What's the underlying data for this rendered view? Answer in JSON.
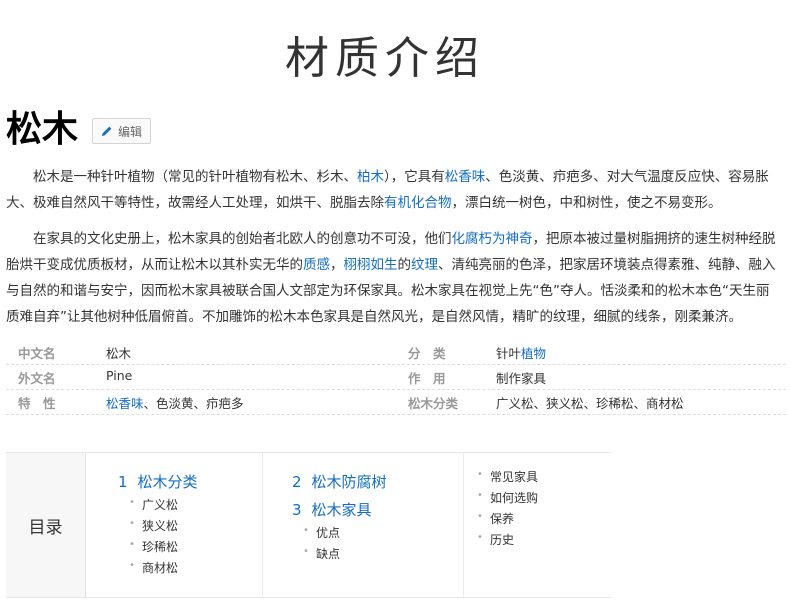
{
  "banner": "材质介绍",
  "title": "松木",
  "edit_label": "编辑",
  "para1": [
    {
      "t": "松木是一种针叶植物（常见的针叶植物有松木、杉木、"
    },
    {
      "t": "柏木",
      "link": true
    },
    {
      "t": "），它具有"
    },
    {
      "t": "松香味",
      "link": true
    },
    {
      "t": "、色淡黄、疖疤多、对大气温度反应快、容易胀大、极难自然风干等特性，故需经人工处理，如烘干、脱脂去除"
    },
    {
      "t": "有机化合物",
      "link": true
    },
    {
      "t": "，漂白统一树色，中和树性，使之不易变形。"
    }
  ],
  "para2": [
    {
      "t": "在家具的文化史册上，松木家具的创始者北欧人的创意功不可没，他们"
    },
    {
      "t": "化腐朽为神奇",
      "link": true
    },
    {
      "t": "，把原本被过量树脂拥挤的速生树种经脱胎烘干变成优质板材，从而让松木以其朴实无华的"
    },
    {
      "t": "质感",
      "link": true
    },
    {
      "t": "，"
    },
    {
      "t": "栩栩如生",
      "link": true
    },
    {
      "t": "的"
    },
    {
      "t": "纹理",
      "link": true
    },
    {
      "t": "、清纯亮丽的色泽，把家居环境装点得素雅、纯静、融入与自然的和谐与安宁，因而松木家具被联合国人文部定为环保家具。松木家具在视觉上先“色”夺人。恬淡柔和的松木本色“天生丽质难自弃”让其他树种低眉俯首。不加雕饰的松木本色家具是自然风光，是自然风情，精旷的纹理，细腻的线条，刚柔兼济。"
    }
  ],
  "info": {
    "rows": [
      {
        "k1": "中文名",
        "v1": [
          {
            "t": "松木"
          }
        ],
        "k2": "分　类",
        "v2": [
          {
            "t": "针叶"
          },
          {
            "t": "植物",
            "link": true
          }
        ]
      },
      {
        "k1": "外文名",
        "v1": [
          {
            "t": "Pine"
          }
        ],
        "k2": "作　用",
        "v2": [
          {
            "t": "制作家具"
          }
        ]
      },
      {
        "k1": "特　性",
        "v1": [
          {
            "t": "松香味",
            "link": true
          },
          {
            "t": "、色淡黄、疖疤多"
          }
        ],
        "k2": "松木分类",
        "v2": [
          {
            "t": "广义松、狭义松、珍稀松、商材松"
          }
        ]
      }
    ]
  },
  "toc": {
    "label": "目录",
    "s1": {
      "num": "1",
      "title": "松木分类",
      "subs": [
        "广义松",
        "狭义松",
        "珍稀松",
        "商材松"
      ]
    },
    "s2": {
      "num": "2",
      "title": "松木防腐树"
    },
    "s3": {
      "num": "3",
      "title": "松木家具",
      "subs": [
        "优点",
        "缺点"
      ]
    },
    "s3_more": [
      "常见家具",
      "如何选购",
      "保养",
      "历史"
    ]
  }
}
